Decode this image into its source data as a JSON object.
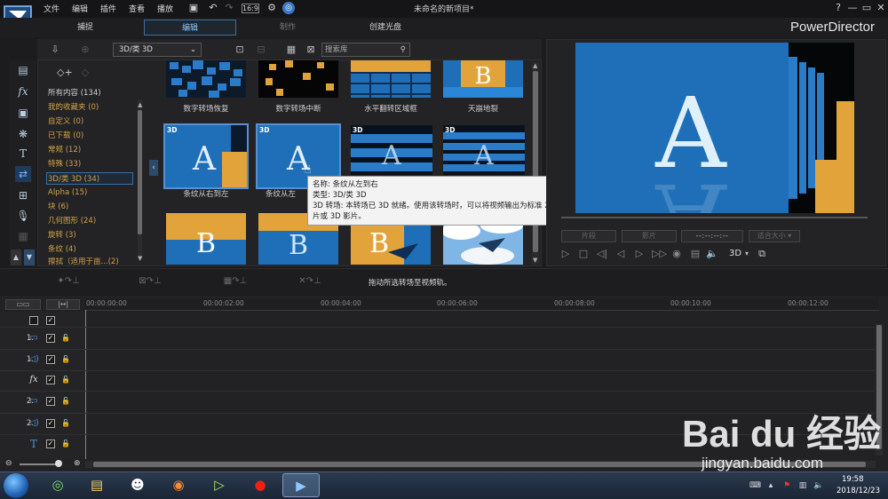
{
  "titlebar": {
    "menus": [
      "文件",
      "编辑",
      "插件",
      "查看",
      "播放"
    ],
    "document_title": "未命名的新项目*",
    "help": "?",
    "minimize": "—",
    "restore": "▭",
    "close": "✕"
  },
  "modebar": {
    "tabs": [
      "捕捉",
      "编辑",
      "制作",
      "创建光盘"
    ],
    "active_tab": "编辑",
    "brand": "PowerDirector"
  },
  "library": {
    "category_select": "3D/类 3D",
    "search_placeholder": "搜索库",
    "categories": [
      "所有内容 (134)",
      "我的收藏夹 (0)",
      "自定义 (0)",
      "已下载 (0)",
      "常规 (12)",
      "特殊 (33)",
      "3D/类 3D (34)",
      "Alpha (15)",
      "块 (6)",
      "几何图形 (24)",
      "旋转 (3)",
      "条纹 (4)",
      "擦拭（适用于亩...(2)"
    ],
    "active_category": "3D/类 3D (34)",
    "items": [
      {
        "label": "数字转场恢复",
        "badge": ""
      },
      {
        "label": "数字转场中断",
        "badge": ""
      },
      {
        "label": "水平翻转区域框",
        "badge": ""
      },
      {
        "label": "天崩地裂",
        "badge": ""
      },
      {
        "label": "条纹从右到左",
        "badge": "3D"
      },
      {
        "label": "条纹从左",
        "badge": "3D"
      },
      {
        "label": "",
        "badge": "3D"
      },
      {
        "label": "",
        "badge": "3D"
      },
      {
        "label": "",
        "badge": ""
      },
      {
        "label": "",
        "badge": ""
      },
      {
        "label": "",
        "badge": ""
      },
      {
        "label": "",
        "badge": ""
      }
    ]
  },
  "tooltip": {
    "name": "名称: 条纹从左到右",
    "type": "类型: 3D/类 3D",
    "desc": "3D 转场: 本转场已 3D 就绪。使用该转场时，可以将视频输出为标准 2D 影片或 3D 影片。"
  },
  "preview": {
    "btn_clip": "片段",
    "btn_movie": "影片",
    "timecode": "--:--:--:--",
    "fit": "适合大小",
    "mode_3d": "3D"
  },
  "status": {
    "message": "拖动所选转场至视频轨。"
  },
  "timeline": {
    "ticks": [
      "00:00:00:00",
      "00:00:02:00",
      "00:00:04:00",
      "00:00:06:00",
      "00:00:08:00",
      "00:00:10:00",
      "00:00:12:00"
    ],
    "tracks": [
      {
        "label": "1.",
        "icon": "video-track-icon"
      },
      {
        "label": "1.",
        "icon": "audio-track-icon"
      },
      {
        "label": "",
        "icon": "fx-track-icon"
      },
      {
        "label": "2.",
        "icon": "video-track-icon"
      },
      {
        "label": "2.",
        "icon": "audio-track-icon"
      },
      {
        "label": "",
        "icon": "title-track-icon"
      }
    ]
  },
  "taskbar": {
    "time": "19:58",
    "date": "2018/12/23"
  },
  "watermark": {
    "logo": "Bai du 经验",
    "url": "jingyan.baidu.com"
  },
  "colors": {
    "accent": "#3a6ea5",
    "category_text": "#d2a24a",
    "thumb_blue": "#1f6fb8",
    "thumb_gold": "#e2a43a"
  }
}
